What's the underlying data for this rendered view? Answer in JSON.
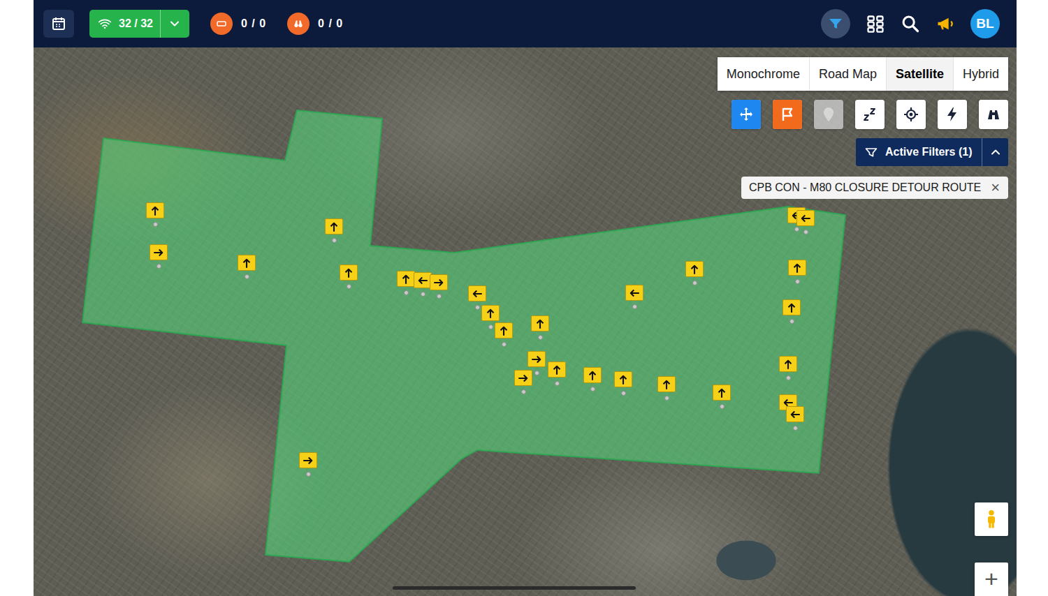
{
  "top_bar": {
    "connection": "32 / 32",
    "counter_a": "0 / 0",
    "counter_b": "0 / 0",
    "avatar": "BL"
  },
  "map_types": [
    {
      "label": "Monochrome",
      "selected": false
    },
    {
      "label": "Road Map",
      "selected": false
    },
    {
      "label": "Satellite",
      "selected": true
    },
    {
      "label": "Hybrid",
      "selected": false
    }
  ],
  "tools": [
    {
      "kind": "move",
      "disabled": false,
      "color": "#1e88f0"
    },
    {
      "kind": "flag",
      "disabled": false,
      "color": "#f26b1d"
    },
    {
      "kind": "pin",
      "disabled": true,
      "color": "#d4d4d4"
    },
    {
      "kind": "sleep",
      "disabled": false,
      "color": "#ffffff"
    },
    {
      "kind": "locate",
      "disabled": false,
      "color": "#ffffff"
    },
    {
      "kind": "bolt",
      "disabled": false,
      "color": "#ffffff"
    },
    {
      "kind": "binoculars",
      "disabled": false,
      "color": "#ffffff"
    }
  ],
  "filters": {
    "label": "Active Filters (1)",
    "expanded": true
  },
  "filter_chips": [
    {
      "label": "CPB CON - M80 CLOSURE DETOUR ROUTE",
      "close": "×"
    }
  ],
  "zoom": {
    "in": "+"
  },
  "markers": [
    {
      "kind": "up"
    },
    {
      "kind": "right"
    },
    {
      "kind": "up"
    },
    {
      "kind": "up"
    },
    {
      "kind": "up"
    },
    {
      "kind": "up"
    },
    {
      "kind": "left"
    },
    {
      "kind": "right"
    },
    {
      "kind": "left"
    },
    {
      "kind": "up"
    },
    {
      "kind": "up"
    },
    {
      "kind": "up"
    },
    {
      "kind": "right"
    },
    {
      "kind": "right"
    },
    {
      "kind": "up"
    },
    {
      "kind": "up"
    },
    {
      "kind": "up"
    },
    {
      "kind": "up"
    },
    {
      "kind": "up"
    },
    {
      "kind": "left"
    },
    {
      "kind": "up"
    },
    {
      "kind": "left"
    },
    {
      "kind": "left"
    },
    {
      "kind": "up"
    },
    {
      "kind": "up"
    },
    {
      "kind": "up"
    },
    {
      "kind": "left"
    },
    {
      "kind": "left"
    },
    {
      "kind": "right"
    }
  ]
}
